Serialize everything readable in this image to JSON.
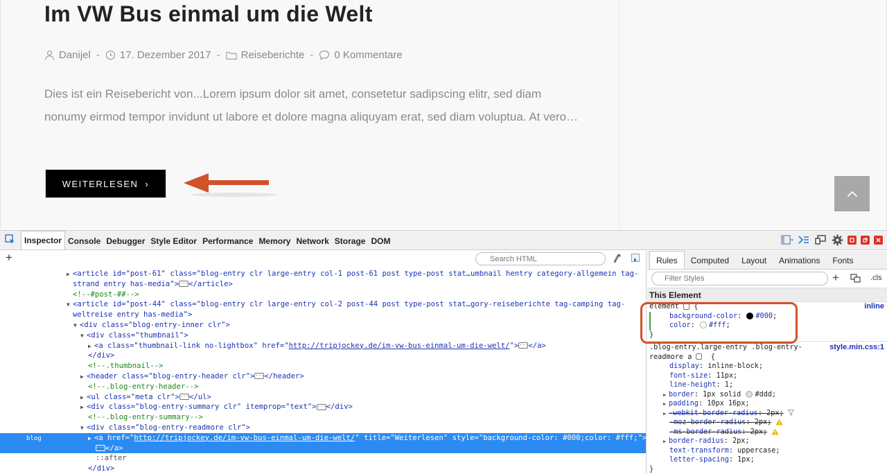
{
  "post": {
    "title": "Im VW Bus einmal um die Welt",
    "meta": {
      "author": "Danijel",
      "date": "17. Dezember 2017",
      "category": "Reiseberichte",
      "comments": "0 Kommentare",
      "separator": "-"
    },
    "summary": "Dies ist ein Reisebericht von...Lorem ipsum dolor sit amet, consetetur sadipscing elitr, sed diam nonumy eirmod tempor invidunt ut labore et dolore magna aliquyam erat, sed diam voluptua. At vero…",
    "readmore_label": "WEITERLESEN",
    "readmore_chevron": "›"
  },
  "colors": {
    "annotation_accent": "#d2522a",
    "selection_blue": "#2c8bf2"
  },
  "devtools": {
    "tabs": [
      "Inspector",
      "Console",
      "Debugger",
      "Style Editor",
      "Performance",
      "Memory",
      "Network",
      "Storage",
      "DOM"
    ],
    "active_tab": "Inspector",
    "search_placeholder": "Search HTML",
    "add_label": "+",
    "markup": {
      "l1a": "<article id=\"post-61\" class=\"blog-entry clr large-entry col-1 post-61 post type-post stat…umbnail hentry category-allgemein tag-",
      "l1b": "strand entry has-media\">",
      "l1c": "</article>",
      "l2": "<!--#post-##-->",
      "l3a": "<article id=\"post-44\" class=\"blog-entry clr large-entry col-2 post-44 post type-post stat…gory-reiseberichte tag-camping tag-",
      "l3b": "weltreise entry has-media\">",
      "l4": "<div class=\"blog-entry-inner clr\">",
      "l5": "<div class=\"thumbnail\">",
      "l6a": "<a class=\"thumbnail-link no-lightbox\" href=\"",
      "l6link": "http://tripjockey.de/im-vw-bus-einmal-um-die-welt/",
      "l6b": "\">",
      "l6c": "</a>",
      "l7": "</div>",
      "l8": "<!--.thumbnail-->",
      "l9a": "<header class=\"blog-entry-header clr\">",
      "l9b": "</header>",
      "l10": "<!--.blog-entry-header-->",
      "l11a": "<ul class=\"meta clr\">",
      "l11b": "</ul>",
      "l12a": "<div class=\"blog-entry-summary clr\" itemprop=\"text\">",
      "l12b": "</div>",
      "l13": "<!--.blog-entry-summary-->",
      "l14": "<div class=\"blog-entry-readmore clr\">",
      "l15a": "<a href=\"",
      "l15link": "http://tripjockey.de/im-vw-bus-einmal-um-die-welt/",
      "l15b": "\" title=\"Weiterlesen\" style=\"background-color: #000;color: #fff;\">",
      "l16": "</a>",
      "l17": "::after",
      "l18": "</div>",
      "badge": "blog"
    },
    "rules": {
      "tabs": [
        "Rules",
        "Computed",
        "Layout",
        "Animations",
        "Fonts"
      ],
      "active_tab": "Rules",
      "filter_placeholder": "Filter Styles",
      "cls_label": ".cls",
      "this_element": "This Element",
      "element_selector": "element",
      "element_source": "inline",
      "element_props": [
        {
          "name": "background-color",
          "value": "#000",
          "swatch": "#000000"
        },
        {
          "name": "color",
          "value": "#fff",
          "swatch": "#ffffff"
        }
      ],
      "rule2_selector_a": ".blog-entry.large-entry .blog-entry-",
      "rule2_selector_b": "readmore a",
      "rule2_source": "style.min.css:1",
      "rule2_props": [
        {
          "name": "display",
          "value": "inline-block"
        },
        {
          "name": "font-size",
          "value": "11px"
        },
        {
          "name": "line-height",
          "value": "1"
        },
        {
          "name": "border",
          "value": "1px solid",
          "swatch": "#dddddd",
          "value2": "#ddd"
        },
        {
          "name": "padding",
          "value": "10px 16px"
        },
        {
          "name": "-webkit-border-radius",
          "value": "2px"
        },
        {
          "name": "-moz-border-radius",
          "value": "2px"
        },
        {
          "name": "-ms-border-radius",
          "value": "2px"
        },
        {
          "name": "border-radius",
          "value": "2px"
        },
        {
          "name": "text-transform",
          "value": "uppercase"
        },
        {
          "name": "letter-spacing",
          "value": "1px"
        }
      ],
      "open_brace": "{",
      "close_brace": "}"
    }
  }
}
